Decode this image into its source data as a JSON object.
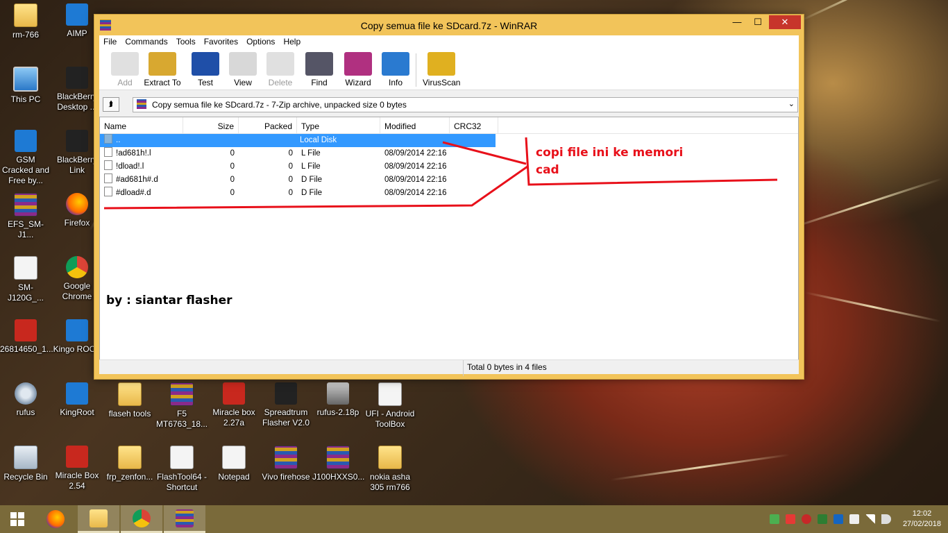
{
  "desktop": {
    "icons": [
      {
        "label": "rm-766",
        "icon": "folder-icon",
        "cls": "folder"
      },
      {
        "label": "AIMP",
        "icon": "aimp-icon",
        "cls": "blue"
      },
      {
        "label": "This PC",
        "icon": "this-pc-icon",
        "cls": "pc"
      },
      {
        "label": "BlackBerry Desktop ...",
        "icon": "blackberry-icon",
        "cls": "black"
      },
      {
        "label": "GSM Cracked and Free by...",
        "icon": "gsm-icon",
        "cls": "blue"
      },
      {
        "label": "BlackBerry Link",
        "icon": "blackberry-icon",
        "cls": "black"
      },
      {
        "label": "EFS_SM-J1...",
        "icon": "winrar-archive-icon",
        "cls": "rar"
      },
      {
        "label": "Firefox",
        "icon": "firefox-icon",
        "cls": "fox"
      },
      {
        "label": "SM-J120G_...",
        "icon": "file-icon",
        "cls": "white"
      },
      {
        "label": "Google Chrome",
        "icon": "chrome-icon",
        "cls": "chrome"
      },
      {
        "label": "26814650_1...",
        "icon": "image-icon",
        "cls": "red"
      },
      {
        "label": "Kingo ROOT",
        "icon": "kingo-root-icon",
        "cls": "blue"
      },
      {
        "label": "rufus",
        "icon": "rufus-icon",
        "cls": "gear"
      },
      {
        "label": "KingRoot",
        "icon": "kingroot-icon",
        "cls": "blue"
      },
      {
        "label": "flaseh tools",
        "icon": "folder-icon",
        "cls": "folder"
      },
      {
        "label": "F5 MT6763_18...",
        "icon": "winrar-archive-icon",
        "cls": "rar"
      },
      {
        "label": "Miracle box 2.27a",
        "icon": "miracle-box-icon",
        "cls": "red"
      },
      {
        "label": "Spreadtrum Flasher V2.0",
        "icon": "spreadtrum-icon",
        "cls": "black"
      },
      {
        "label": "rufus-2.18p",
        "icon": "usb-icon",
        "cls": "usb"
      },
      {
        "label": "UFI - Android ToolBox",
        "icon": "ufi-icon",
        "cls": "white"
      },
      {
        "label": "Recycle Bin",
        "icon": "recycle-bin-icon",
        "cls": "bin"
      },
      {
        "label": "Miracle Box 2.54",
        "icon": "miracle-box-icon",
        "cls": "red"
      },
      {
        "label": "frp_zenfon...",
        "icon": "folder-icon",
        "cls": "folder"
      },
      {
        "label": "FlashTool64 - Shortcut",
        "icon": "shortcut-icon",
        "cls": "white"
      },
      {
        "label": "Notepad",
        "icon": "notepad-icon",
        "cls": "white"
      },
      {
        "label": "Vivo firehose",
        "icon": "winrar-archive-icon",
        "cls": "rar"
      },
      {
        "label": "J100HXXS0...",
        "icon": "winrar-archive-icon",
        "cls": "rar"
      },
      {
        "label": "nokia asha 305 rm766",
        "icon": "folder-icon",
        "cls": "folder"
      }
    ]
  },
  "window": {
    "title": "Copy semua file ke SDcard.7z - WinRAR",
    "minimize": "—",
    "maximize": "☐",
    "close": "✕"
  },
  "menu": [
    "File",
    "Commands",
    "Tools",
    "Favorites",
    "Options",
    "Help"
  ],
  "toolbar": [
    {
      "label": "Add",
      "icon": "add-icon",
      "disabled": true
    },
    {
      "label": "Extract To",
      "icon": "extract-to-icon",
      "disabled": false
    },
    {
      "label": "Test",
      "icon": "test-icon",
      "disabled": false
    },
    {
      "label": "View",
      "icon": "view-icon",
      "disabled": false
    },
    {
      "label": "Delete",
      "icon": "delete-icon",
      "disabled": true
    },
    {
      "label": "Find",
      "icon": "find-icon",
      "disabled": false
    },
    {
      "label": "Wizard",
      "icon": "wizard-icon",
      "disabled": false
    },
    {
      "label": "Info",
      "icon": "info-icon",
      "disabled": false
    },
    {
      "label": "VirusScan",
      "icon": "virusscan-icon",
      "disabled": false
    }
  ],
  "address": {
    "text": "Copy semua file ke SDcard.7z - 7-Zip archive, unpacked size 0 bytes",
    "up_icon": "up-folder-icon"
  },
  "columns": [
    "Name",
    "Size",
    "Packed",
    "Type",
    "Modified",
    "CRC32"
  ],
  "rows": [
    {
      "name": "..",
      "size": "",
      "packed": "",
      "type": "Local Disk",
      "modified": "",
      "crc": "",
      "selected": true
    },
    {
      "name": "!ad681h!.l",
      "size": "0",
      "packed": "0",
      "type": "L File",
      "modified": "08/09/2014 22:16",
      "crc": "",
      "selected": false
    },
    {
      "name": "!dload!.l",
      "size": "0",
      "packed": "0",
      "type": "L File",
      "modified": "08/09/2014 22:16",
      "crc": "",
      "selected": false
    },
    {
      "name": "#ad681h#.d",
      "size": "0",
      "packed": "0",
      "type": "D File",
      "modified": "08/09/2014 22:16",
      "crc": "",
      "selected": false
    },
    {
      "name": "#dload#.d",
      "size": "0",
      "packed": "0",
      "type": "D File",
      "modified": "08/09/2014 22:16",
      "crc": "",
      "selected": false
    }
  ],
  "status": {
    "text": "Total 0 bytes in 4 files"
  },
  "annotations": {
    "note_line1": "copi file ini ke memori",
    "note_line2": "cad",
    "byline": "by : siantar flasher",
    "stroke_color": "#e8101a"
  },
  "taskbar": {
    "apps": [
      {
        "name": "firefox",
        "icon": "firefox-icon"
      },
      {
        "name": "file-explorer",
        "icon": "file-explorer-icon"
      },
      {
        "name": "chrome",
        "icon": "chrome-icon"
      },
      {
        "name": "winrar",
        "icon": "winrar-icon"
      }
    ],
    "time": "12:02",
    "date": "27/02/2018"
  }
}
